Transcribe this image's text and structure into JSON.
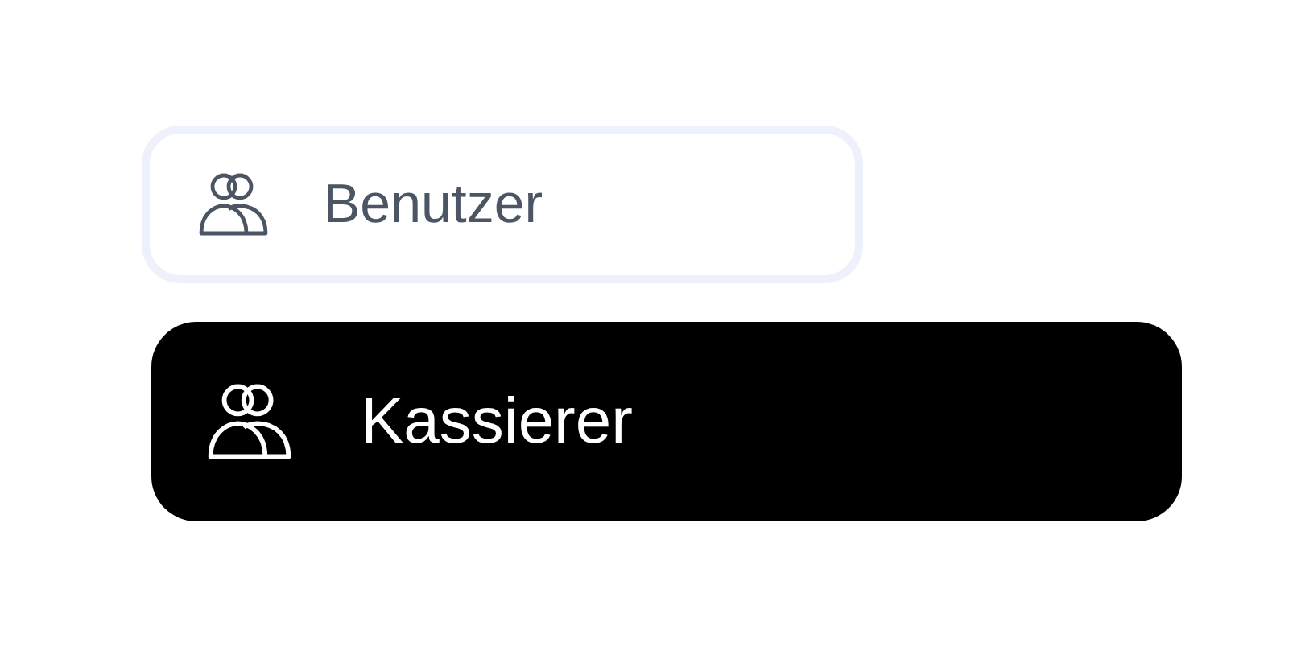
{
  "menu_items": [
    {
      "label": "Benutzer",
      "selected": false
    },
    {
      "label": "Kassierer",
      "selected": true
    }
  ]
}
